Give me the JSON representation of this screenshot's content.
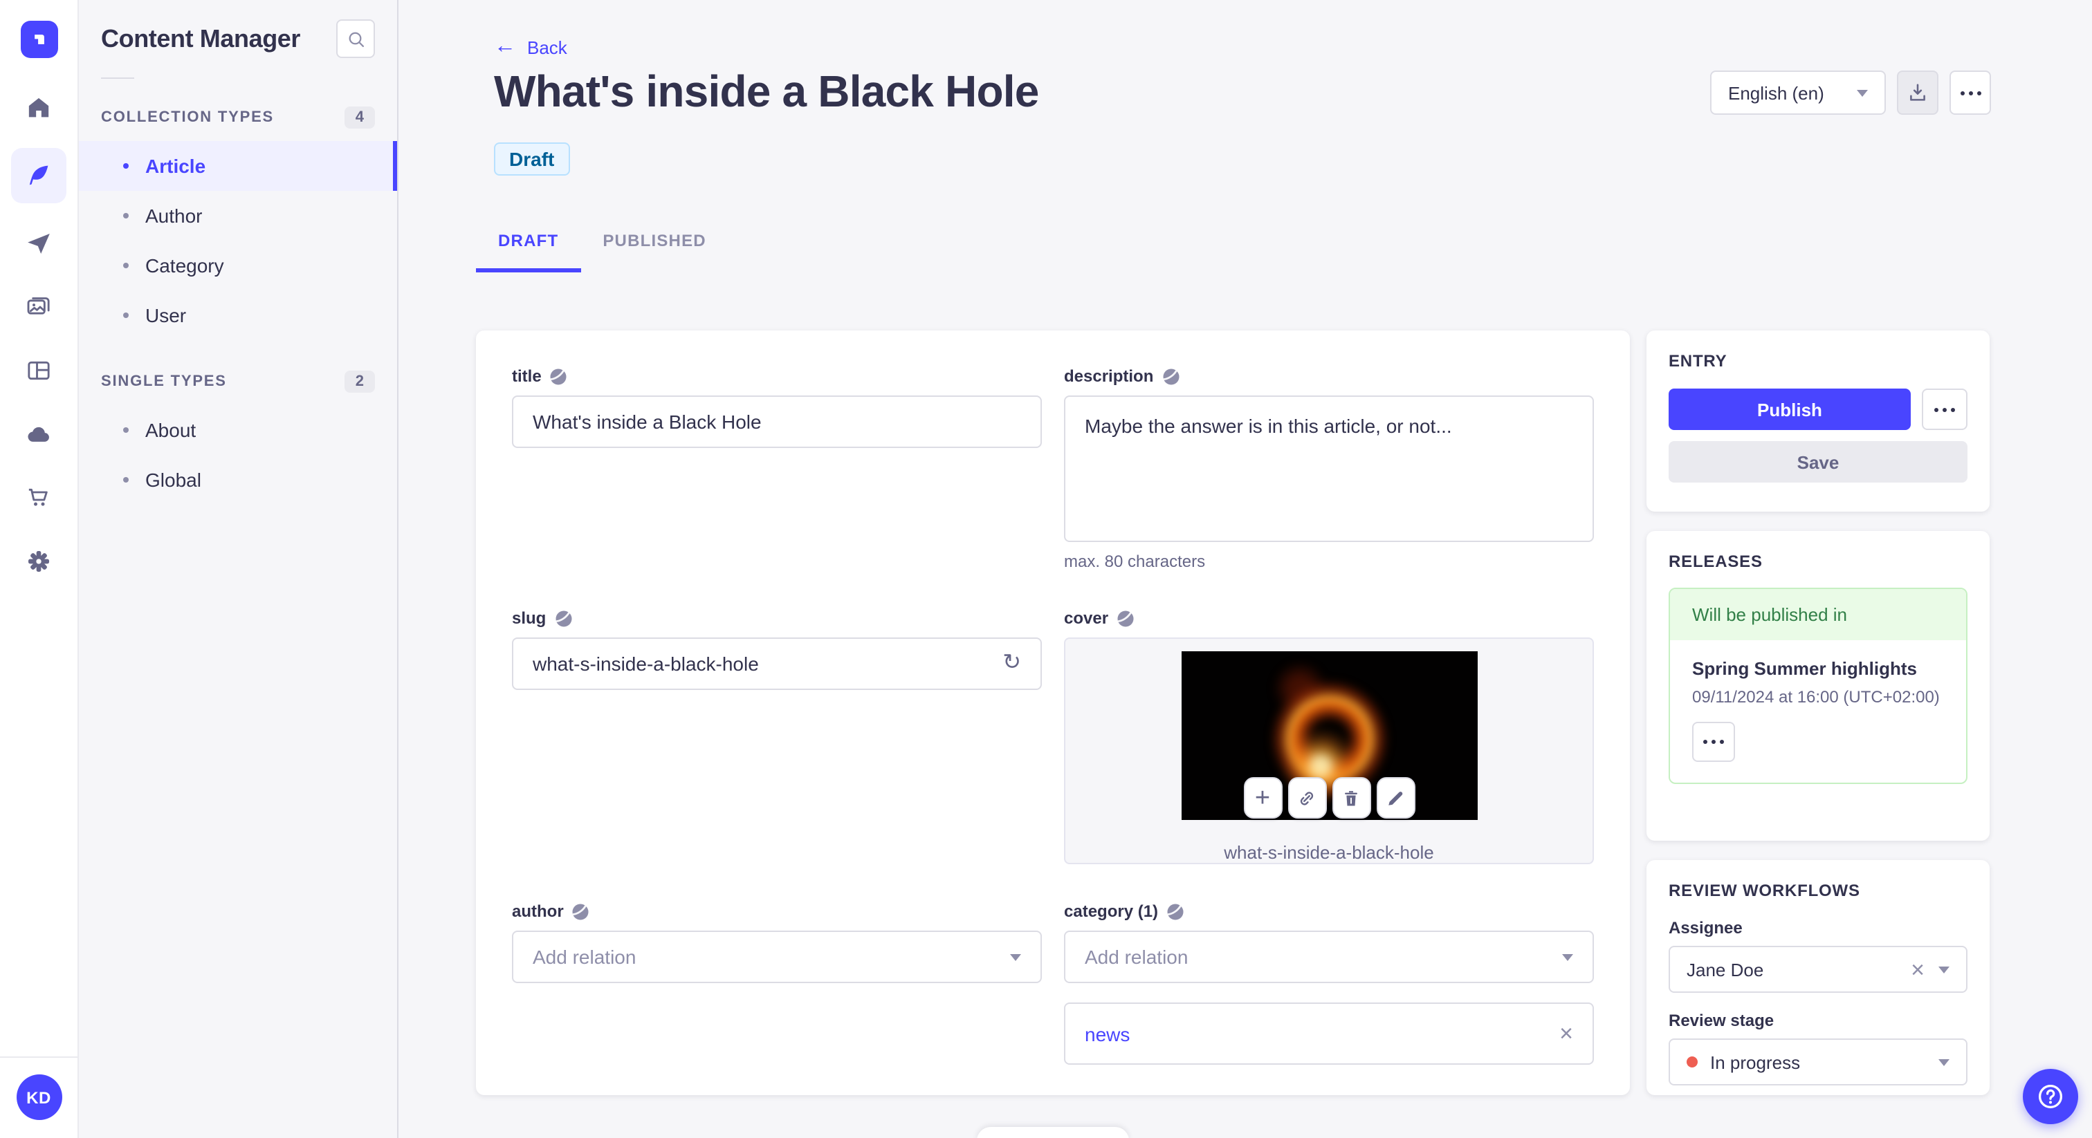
{
  "sidebar": {
    "title": "Content Manager",
    "sections": [
      {
        "label": "COLLECTION TYPES",
        "count": "4",
        "items": [
          {
            "label": "Article"
          },
          {
            "label": "Author"
          },
          {
            "label": "Category"
          },
          {
            "label": "User"
          }
        ]
      },
      {
        "label": "SINGLE TYPES",
        "count": "2",
        "items": [
          {
            "label": "About"
          },
          {
            "label": "Global"
          }
        ]
      }
    ]
  },
  "header": {
    "back_label": "Back",
    "title": "What's inside a Black Hole",
    "status_badge": "Draft",
    "locale_selected": "English (en)",
    "tabs": [
      {
        "label": "DRAFT"
      },
      {
        "label": "PUBLISHED"
      }
    ]
  },
  "form": {
    "title_field": {
      "label": "title",
      "value": "What's inside a Black Hole"
    },
    "description_field": {
      "label": "description",
      "value": "Maybe the answer is in this article, or not...",
      "hint": "max. 80 characters"
    },
    "slug_field": {
      "label": "slug",
      "value": "what-s-inside-a-black-hole"
    },
    "cover_field": {
      "label": "cover",
      "caption": "what-s-inside-a-black-hole"
    },
    "author_field": {
      "label": "author",
      "placeholder": "Add relation"
    },
    "category_field": {
      "label": "category (1)",
      "placeholder": "Add relation",
      "relation": "news"
    }
  },
  "entry_panel": {
    "heading": "ENTRY",
    "publish_label": "Publish",
    "save_label": "Save"
  },
  "releases_panel": {
    "heading": "RELEASES",
    "banner": "Will be published in",
    "release_name": "Spring Summer highlights",
    "release_date": "09/11/2024 at 16:00 (UTC+02:00)"
  },
  "review_panel": {
    "heading": "REVIEW WORKFLOWS",
    "assignee_label": "Assignee",
    "assignee_value": "Jane Doe",
    "stage_label": "Review stage",
    "stage_value": "In progress"
  },
  "user": {
    "initials": "KD"
  },
  "colors": {
    "primary": "#4945ff",
    "primary_light": "#f0f0ff",
    "success_text": "#328048",
    "success_bg": "#eafbe7",
    "success_border": "#c6f0c2",
    "danger": "#ee5e52",
    "draft_badge_bg": "#eaf5ff",
    "draft_badge_text": "#006096",
    "draft_badge_border": "#b8e1ff",
    "app_bg": "#f6f6f9",
    "text": "#32324d",
    "subtext": "#666687",
    "border": "#dcdce4"
  }
}
